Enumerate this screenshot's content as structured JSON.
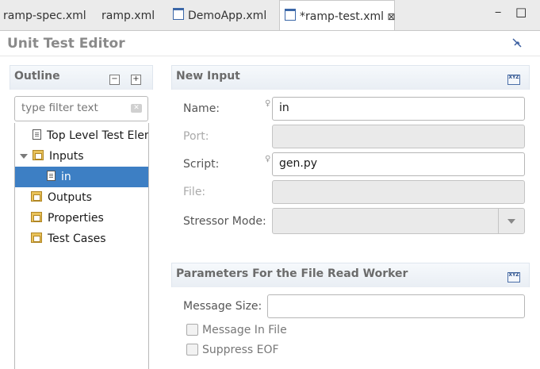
{
  "tabs": [
    {
      "label": "ramp-spec.xml",
      "active": false,
      "icon": "none"
    },
    {
      "label": "ramp.xml",
      "active": false,
      "icon": "none"
    },
    {
      "label": "DemoApp.xml",
      "active": false,
      "icon": "editor-icon"
    },
    {
      "label": "*ramp-test.xml",
      "active": true,
      "icon": "editor-icon",
      "close_glyph": "⊠"
    }
  ],
  "window": {
    "minimize": "‒",
    "maximize": "□"
  },
  "editor": {
    "title": "Unit Test Editor"
  },
  "outline": {
    "title": "Outline",
    "filter_placeholder": "type filter text",
    "items": [
      {
        "label": "Top Level Test Elem",
        "icon": "document-icon"
      },
      {
        "label": "Inputs",
        "icon": "folder-icon",
        "expanded": true
      },
      {
        "label": "in",
        "icon": "document-icon",
        "selected": true
      },
      {
        "label": "Outputs",
        "icon": "folder-icon"
      },
      {
        "label": "Properties",
        "icon": "folder-icon"
      },
      {
        "label": "Test Cases",
        "icon": "folder-icon"
      }
    ]
  },
  "new_input": {
    "title": "New Input",
    "name_label": "Name:",
    "name_value": "in",
    "port_label": "Port:",
    "port_value": "",
    "script_label": "Script:",
    "script_value": "gen.py",
    "file_label": "File:",
    "file_value": "",
    "stressor_label": "Stressor Mode:",
    "stressor_value": ""
  },
  "params": {
    "title": "Parameters For the File Read Worker",
    "message_size_label": "Message Size:",
    "message_size_value": "",
    "message_in_file_label": "Message In File",
    "message_in_file_checked": false,
    "suppress_eof_label": "Suppress EOF",
    "suppress_eof_checked": false
  },
  "colors": {
    "selection": "#3d7fc4",
    "title_gray": "#8a8a8a"
  }
}
